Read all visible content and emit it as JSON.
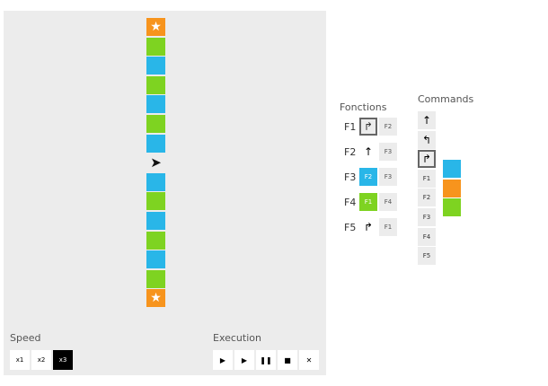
{
  "board": {
    "tiles": [
      {
        "color": "orange",
        "symbol": "★"
      },
      {
        "color": "green",
        "symbol": ""
      },
      {
        "color": "blue",
        "symbol": ""
      },
      {
        "color": "green",
        "symbol": ""
      },
      {
        "color": "blue",
        "symbol": ""
      },
      {
        "color": "green",
        "symbol": ""
      },
      {
        "color": "blue",
        "symbol": ""
      },
      {
        "color": "black",
        "symbol": "➤"
      },
      {
        "color": "blue",
        "symbol": ""
      },
      {
        "color": "green",
        "symbol": ""
      },
      {
        "color": "blue",
        "symbol": ""
      },
      {
        "color": "green",
        "symbol": ""
      },
      {
        "color": "blue",
        "symbol": ""
      },
      {
        "color": "green",
        "symbol": ""
      },
      {
        "color": "orange",
        "symbol": "★"
      }
    ]
  },
  "speed": {
    "label": "Speed",
    "options": [
      "x1",
      "x2",
      "x3"
    ],
    "selected": "x3"
  },
  "execution": {
    "label": "Execution",
    "play": "▶",
    "step": "▶",
    "pause": "❚❚",
    "stop": "■",
    "clear": "✕"
  },
  "functions": {
    "label": "Fonctions",
    "rows": [
      {
        "name": "F1",
        "a": "↱",
        "b": "F2"
      },
      {
        "name": "F2",
        "a": "↑",
        "b": "F3"
      },
      {
        "name": "F3",
        "a": "F2",
        "b": "F3"
      },
      {
        "name": "F4",
        "a": "F1",
        "b": "F4"
      },
      {
        "name": "F5",
        "a": "↱",
        "b": "F1"
      }
    ]
  },
  "commands": {
    "label": "Commands",
    "forward": "↑",
    "left": "↰",
    "right": "↱",
    "calls": [
      "F1",
      "F2",
      "F3",
      "F4",
      "F5"
    ]
  },
  "colors": {
    "blue": "#29b6e8",
    "orange": "#f7941d",
    "green": "#7ed321"
  }
}
